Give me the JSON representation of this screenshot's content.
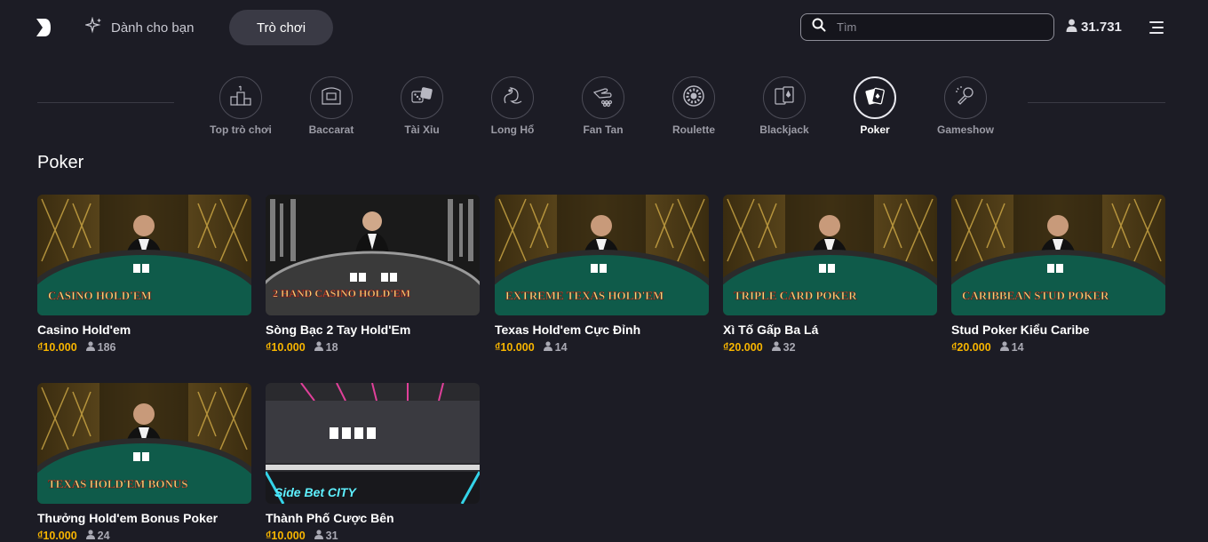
{
  "header": {
    "for_you_label": "Dành cho bạn",
    "games_label": "Trò chơi",
    "search_placeholder": "Tìm",
    "online_count": "31.731"
  },
  "categories": [
    {
      "label": "Top trò chơi",
      "icon": "trophy-podium-icon",
      "active": false
    },
    {
      "label": "Baccarat",
      "icon": "baccarat-table-icon",
      "active": false
    },
    {
      "label": "Tài Xỉu",
      "icon": "dice-icon",
      "active": false
    },
    {
      "label": "Long Hổ",
      "icon": "dragon-icon",
      "active": false
    },
    {
      "label": "Fan Tan",
      "icon": "hand-beads-icon",
      "active": false
    },
    {
      "label": "Roulette",
      "icon": "roulette-wheel-icon",
      "active": false
    },
    {
      "label": "Blackjack",
      "icon": "blackjack-cards-icon",
      "active": false
    },
    {
      "label": "Poker",
      "icon": "poker-cards-icon",
      "active": true
    },
    {
      "label": "Gameshow",
      "icon": "gameshow-microphone-icon",
      "active": false
    }
  ],
  "section": {
    "title": "Poker"
  },
  "games": [
    {
      "name": "Casino Hold'em",
      "price": "₫10.000",
      "players": "186",
      "logo_text": "CASINO HOLD'EM",
      "theme": "gold"
    },
    {
      "name": "Sòng Bạc 2 Tay Hold'Em",
      "price": "₫10.000",
      "players": "18",
      "logo_text": "2 HAND CASINO HOLD'EM",
      "theme": "silver"
    },
    {
      "name": "Texas Hold'em Cực Đỉnh",
      "price": "₫10.000",
      "players": "14",
      "logo_text": "EXTREME TEXAS HOLD'EM",
      "theme": "gold"
    },
    {
      "name": "Xì Tố Gấp Ba Lá",
      "price": "₫20.000",
      "players": "32",
      "logo_text": "TRIPLE CARD POKER",
      "theme": "gold"
    },
    {
      "name": "Stud Poker Kiểu Caribe",
      "price": "₫20.000",
      "players": "14",
      "logo_text": "CARIBBEAN STUD POKER",
      "theme": "gold"
    },
    {
      "name": "Thưởng Hold'em Bonus Poker",
      "price": "₫10.000",
      "players": "24",
      "logo_text": "TEXAS HOLD'EM BONUS",
      "theme": "gold"
    },
    {
      "name": "Thành Phố Cược Bên",
      "price": "₫10.000",
      "players": "31",
      "logo_text": "Side Bet CITY",
      "theme": "neon"
    }
  ]
}
